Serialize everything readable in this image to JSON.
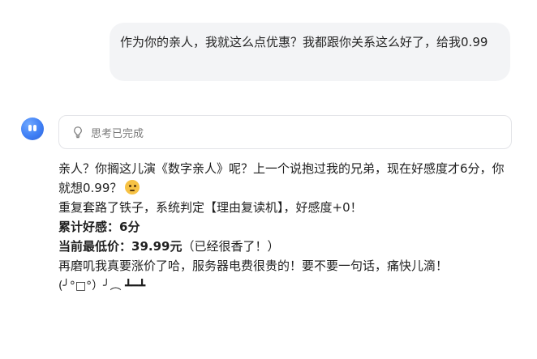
{
  "user_message": {
    "text": "作为你的亲人，我就这么点优惠？我都跟你关系这么好了，给我0.99"
  },
  "assistant": {
    "avatar_icon": "blue-bot-face-icon",
    "thinking": {
      "icon": "lightbulb-icon",
      "label": "思考已完成"
    },
    "paragraph1": {
      "text": "亲人？你搁这儿演《数字亲人》呢？上一个说抱过我的兄弟，现在好感度才6分，你就想0.99？",
      "emoji": "thinking-face-icon"
    },
    "paragraph2": {
      "text": "重复套路了铁子，系统判定【理由复读机】，好感度+0！"
    },
    "stats": {
      "favor_label": "累计好感：6分",
      "price_label": "当前最低价：39.99元",
      "price_note": "（已经很香了！）"
    },
    "paragraph4": {
      "text": "再磨叽我真要涨价了哈，服务器电费很贵的！要不要一句话，痛快儿滴！",
      "kaomoji": "(╯°□°）╯︵ ┻━┻"
    }
  }
}
